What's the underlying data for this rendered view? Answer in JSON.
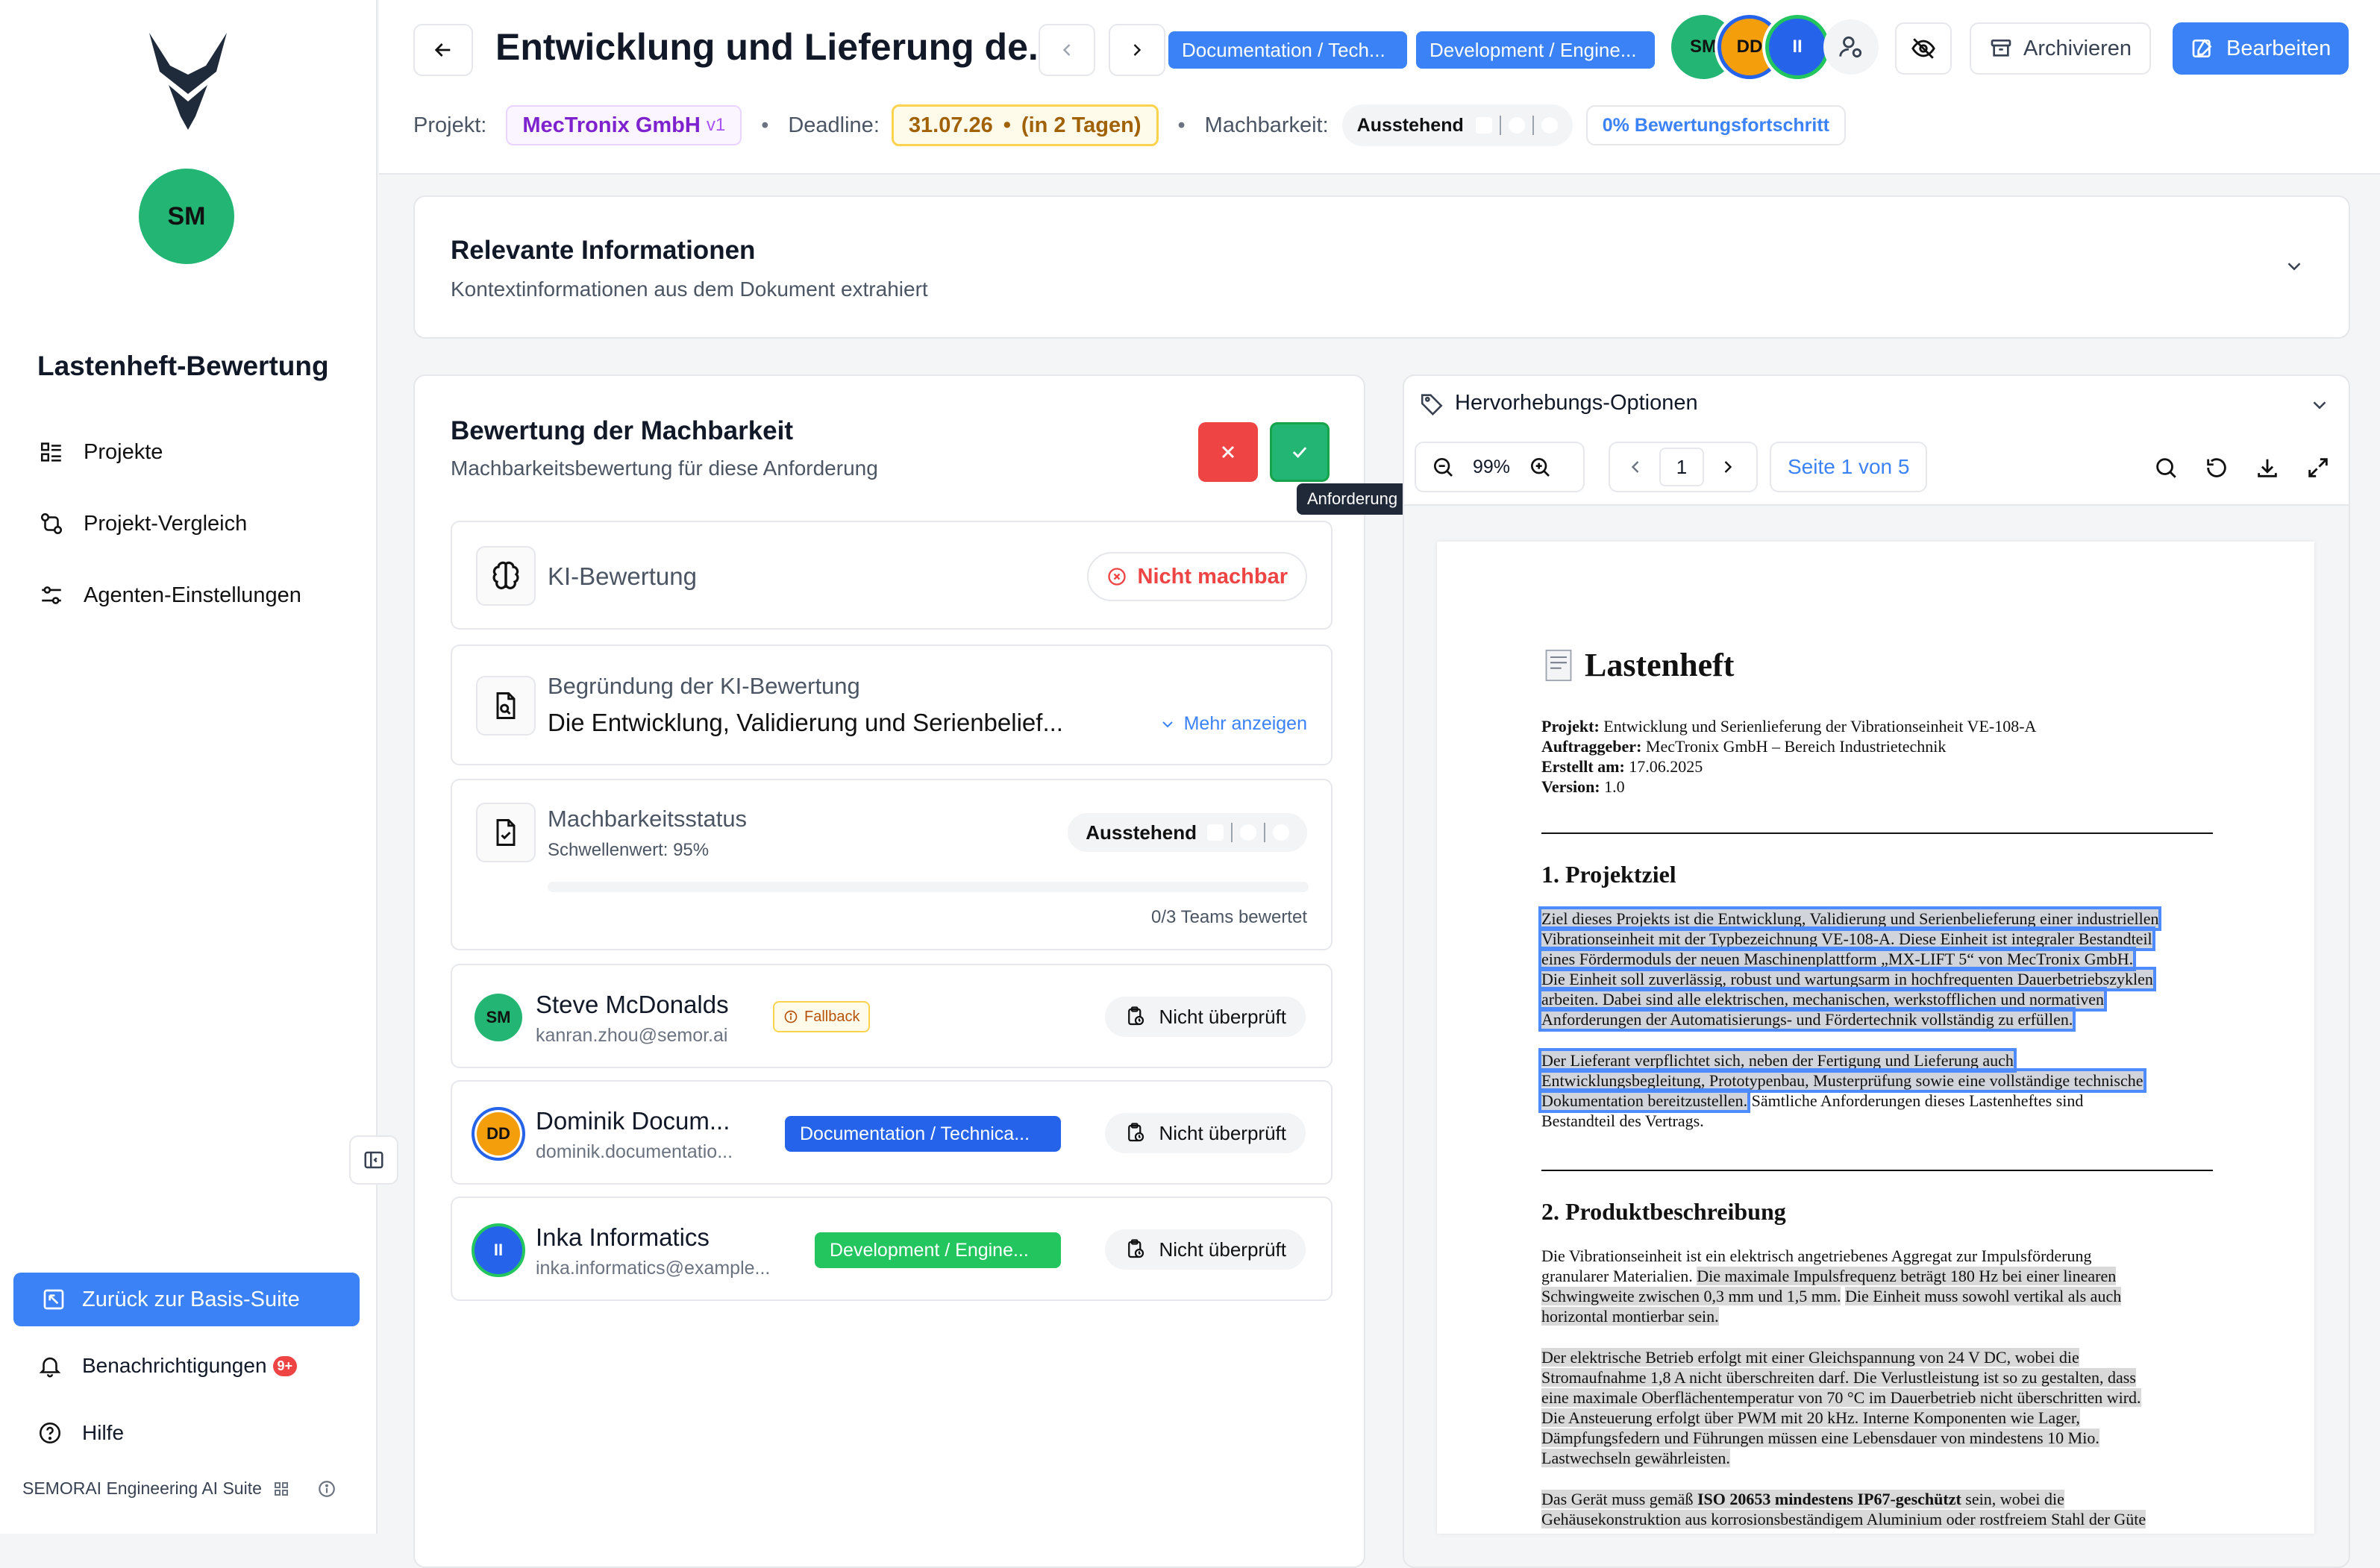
{
  "sidebar": {
    "user_initials": "SM",
    "app_title": "Lastenheft-Bewertung",
    "nav": [
      {
        "label": "Projekte",
        "icon": "list-icon"
      },
      {
        "label": "Projekt-Vergleich",
        "icon": "compare-icon"
      },
      {
        "label": "Agenten-Einstellungen",
        "icon": "settings-icon"
      }
    ],
    "back_suite": "Zurück zur Basis-Suite",
    "notifications": "Benachrichtigungen",
    "notif_badge": "9+",
    "help": "Hilfe",
    "brand": "SEMORAI Engineering AI Suite"
  },
  "header": {
    "title": "Entwicklung und Lieferung de...",
    "tags": [
      "Documentation / Tech...",
      "Development / Engine..."
    ],
    "avatars": [
      "SM",
      "DD",
      "II"
    ],
    "archive": "Archivieren",
    "edit": "Bearbeiten",
    "project_label": "Projekt:",
    "project_name": "MecTronix GmbH",
    "project_version": "v1",
    "deadline_label": "Deadline:",
    "deadline_date": "31.07.26",
    "deadline_rel": "(in 2 Tagen)",
    "feasibility_label": "Machbarkeit:",
    "feasibility_status": "Ausstehend",
    "progress": "0% Bewertungsfortschritt"
  },
  "info_card": {
    "title": "Relevante Informationen",
    "subtitle": "Kontextinformationen aus dem Dokument extrahiert"
  },
  "assessment": {
    "title": "Bewertung der Machbarkeit",
    "subtitle": "Machbarkeitsbewertung für diese Anforderung",
    "tooltip": "Anforderung akzeptieren (Machbar)",
    "ki_label": "KI-Bewertung",
    "ki_result": "Nicht machbar",
    "reason_label": "Begründung der KI-Bewertung",
    "reason_text": "Die Entwicklung, Validierung und Serienbelief...",
    "more": "Mehr anzeigen",
    "status_label": "Machbarkeitsstatus",
    "threshold": "Schwellenwert: 95%",
    "status_value": "Ausstehend",
    "teams_rated": "0/3 Teams bewertet",
    "teams_rated_fraction": 0,
    "members": [
      {
        "initials": "SM",
        "name": "Steve McDonalds",
        "email": "kanran.zhou@semor.ai",
        "tag": "Fallback",
        "status": "Nicht überprüft"
      },
      {
        "initials": "DD",
        "name": "Dominik Docum...",
        "email": "dominik.documentatio...",
        "tag": "Documentation / Technica...",
        "status": "Nicht überprüft"
      },
      {
        "initials": "II",
        "name": "Inka Informatics",
        "email": "inka.informatics@example...",
        "tag": "Development / Engine...",
        "status": "Nicht überprüft"
      }
    ]
  },
  "viewer": {
    "highlight_options": "Hervorhebungs-Optionen",
    "zoom": "99%",
    "page_input": "1",
    "page_label": "Seite 1 von 5"
  },
  "document": {
    "heading": "Lastenheft",
    "meta": [
      {
        "k": "Projekt:",
        "v": "Entwicklung und Serienlieferung der Vibrationseinheit VE-108-A"
      },
      {
        "k": "Auftraggeber:",
        "v": "MecTronix GmbH – Bereich Industrietechnik"
      },
      {
        "k": "Erstellt am:",
        "v": "17.06.2025"
      },
      {
        "k": "Version:",
        "v": "1.0"
      }
    ],
    "s1_title": "1. Projektziel",
    "s1_lines": [
      "Ziel dieses Projekts ist die Entwicklung, Validierung und Serienbelieferung einer industriellen",
      "Vibrationseinheit mit der Typbezeichnung VE-108-A. Diese Einheit ist integraler Bestandteil",
      "eines Fördermoduls der neuen Maschinenplattform „MX-LIFT 5“ von MecTronix GmbH.",
      "Die Einheit soll zuverlässig, robust und wartungsarm in hochfrequenten Dauerbetriebszyklen",
      "arbeiten. Dabei sind alle elektrischen, mechanischen, werkstofflichen und normativen",
      "Anforderungen der Automatisierungs- und Fördertechnik vollständig zu erfüllen."
    ],
    "s1b_lines": [
      "Der Lieferant verpflichtet sich, neben der Fertigung und Lieferung auch",
      "Entwicklungsbegleitung, Prototypenbau, Musterprüfung sowie eine vollständige technische",
      "Dokumentation bereitzustellen."
    ],
    "s1b_tail": " Sämtliche Anforderungen dieses Lastenheftes sind",
    "s1b_end": "Bestandteil des Vertrags.",
    "s2_title": "2. Produktbeschreibung",
    "p2_1a": "Die Vibrationseinheit ist ein elektrisch angetriebenes Aggregat zur Impulsförderung",
    "p2_1b": "granularer Materialien.",
    "p2_1c": "Die maximale Impulsfrequenz beträgt 180 Hz bei einer linearen",
    "p2_1d": "Schwingweite zwischen 0,3 mm und 1,5 mm.",
    "p2_1e": "Die Einheit muss sowohl vertikal als auch",
    "p2_1f": "horizontal montierbar sein.",
    "p2_2": [
      "Der elektrische Betrieb erfolgt mit einer Gleichspannung von 24 V DC, wobei die",
      "Stromaufnahme 1,8 A nicht überschreiten darf. Die Verlustleistung ist so zu gestalten, dass",
      "eine maximale Oberflächentemperatur von 70 °C im Dauerbetrieb nicht überschritten wird.",
      "Die Ansteuerung erfolgt über PWM mit 20 kHz. Interne Komponenten wie Lager,",
      "Dämpfungsfedern und Führungen müssen eine Lebensdauer von mindestens 10 Mio.",
      "Lastwechseln gewährleisten."
    ],
    "p2_3a": "Das Gerät muss gemäß ",
    "p2_3b": "ISO 20653 mindestens IP67-geschützt",
    "p2_3c": " sein, wobei die",
    "p2_3d": "Gehäusekonstruktion aus korrosionsbeständigem Aluminium oder rostfreiem Stahl der Güte"
  }
}
